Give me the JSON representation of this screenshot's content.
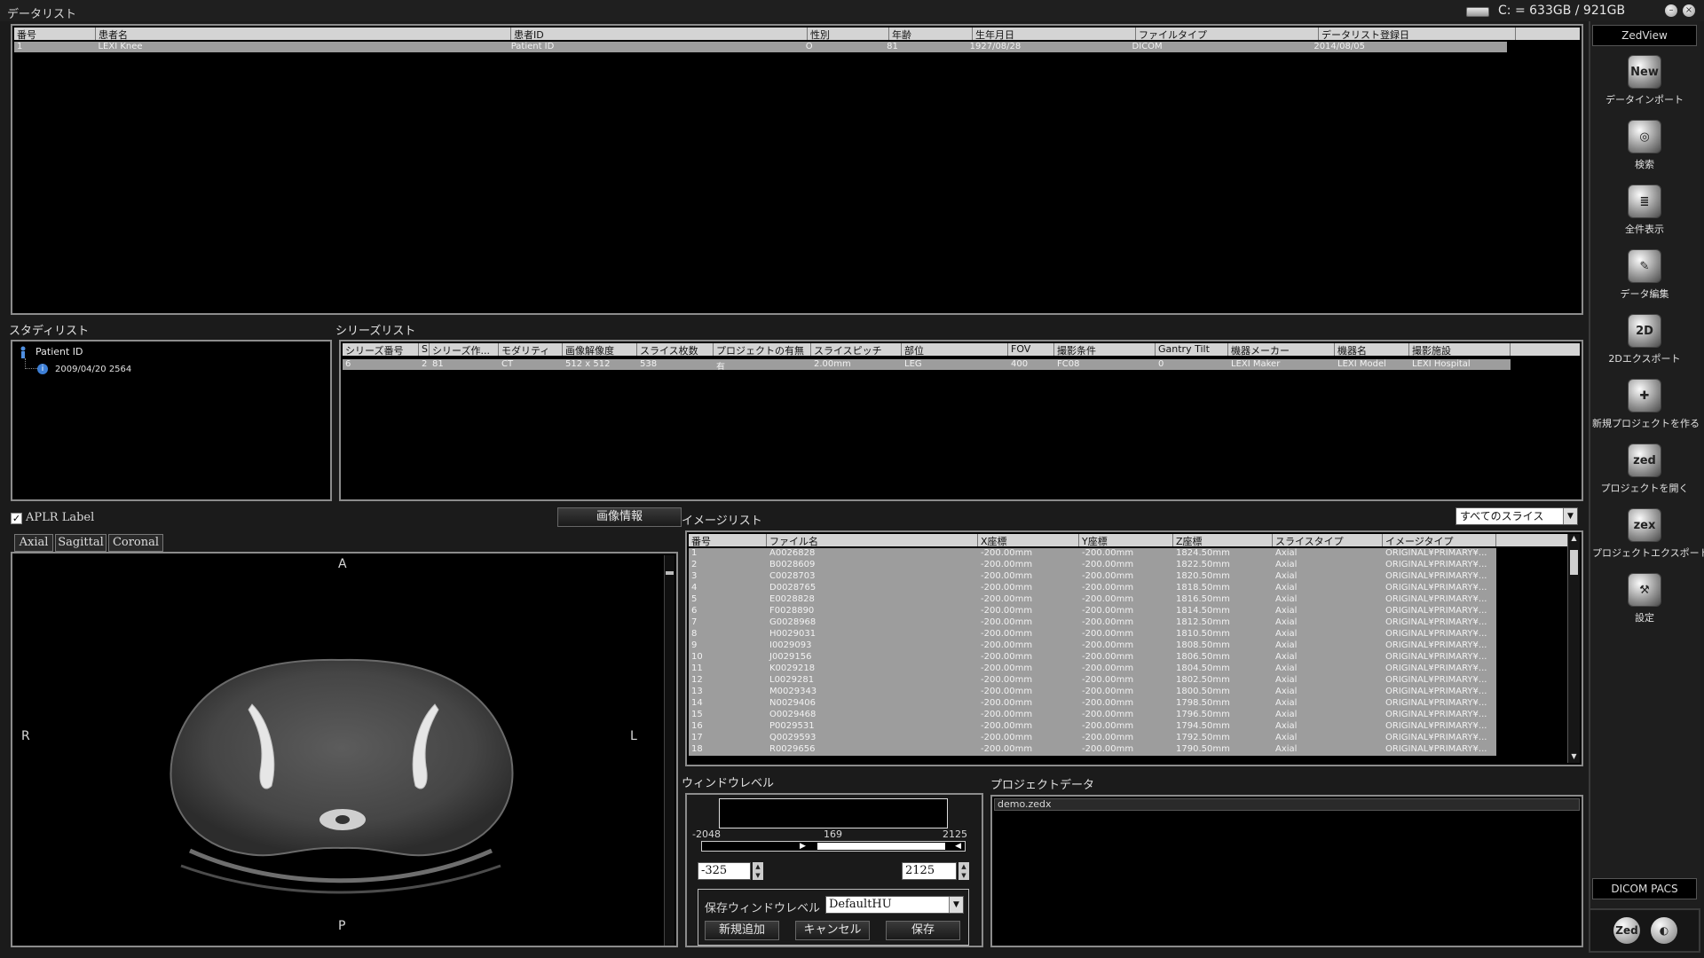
{
  "topbar": {
    "title": "データリスト",
    "drive": "C: = 633GB / 921GB",
    "min_icon": "minimize-icon",
    "close_icon": "close-icon"
  },
  "data_list": {
    "columns": [
      "番号",
      "患者名",
      "患者ID",
      "性別",
      "年齢",
      "生年月日",
      "ファイルタイプ",
      "データリスト登録日"
    ],
    "rows": [
      [
        "1",
        "LEXI Knee",
        "Patient ID",
        "O",
        "81",
        "1927/08/28",
        "DICOM",
        "2014/08/05"
      ]
    ]
  },
  "study_list": {
    "title": "スタディリスト",
    "root": "Patient ID",
    "child": "2009/04/20 2564"
  },
  "series_list": {
    "title": "シリーズリスト",
    "columns": [
      "シリーズ番号",
      "S",
      "シリーズ作...",
      "モダリティ",
      "画像解像度",
      "スライス枚数",
      "プロジェクトの有無",
      "スライスピッチ",
      "部位",
      "FOV",
      "撮影条件",
      "Gantry Tilt",
      "機器メーカー",
      "機器名",
      "撮影施設"
    ],
    "rows": [
      [
        "6",
        "2",
        "81",
        "CT",
        "512 x 512",
        "538",
        "有",
        "2.00mm",
        "LEG",
        "400",
        "FC08",
        "0",
        "LEXI Maker",
        "LEXI Model",
        "LEXI Hospital"
      ]
    ]
  },
  "viewer": {
    "aplr_label": "APLR Label",
    "image_info_button": "画像情報",
    "tabs": [
      "Axial",
      "Sagittal",
      "Coronal"
    ],
    "orient": {
      "top": "A",
      "bottom": "P",
      "left": "R",
      "right": "L"
    }
  },
  "image_list": {
    "title": "イメージリスト",
    "filter": "すべてのスライス",
    "columns": [
      "番号",
      "ファイル名",
      "X座標",
      "Y座標",
      "Z座標",
      "スライスタイプ",
      "イメージタイプ"
    ],
    "rows": [
      [
        "1",
        "A0026828",
        "-200.00mm",
        "-200.00mm",
        "1824.50mm",
        "Axial",
        "ORIGINAL¥PRIMARY¥..."
      ],
      [
        "2",
        "B0028609",
        "-200.00mm",
        "-200.00mm",
        "1822.50mm",
        "Axial",
        "ORIGINAL¥PRIMARY¥..."
      ],
      [
        "3",
        "C0028703",
        "-200.00mm",
        "-200.00mm",
        "1820.50mm",
        "Axial",
        "ORIGINAL¥PRIMARY¥..."
      ],
      [
        "4",
        "D0028765",
        "-200.00mm",
        "-200.00mm",
        "1818.50mm",
        "Axial",
        "ORIGINAL¥PRIMARY¥..."
      ],
      [
        "5",
        "E0028828",
        "-200.00mm",
        "-200.00mm",
        "1816.50mm",
        "Axial",
        "ORIGINAL¥PRIMARY¥..."
      ],
      [
        "6",
        "F0028890",
        "-200.00mm",
        "-200.00mm",
        "1814.50mm",
        "Axial",
        "ORIGINAL¥PRIMARY¥..."
      ],
      [
        "7",
        "G0028968",
        "-200.00mm",
        "-200.00mm",
        "1812.50mm",
        "Axial",
        "ORIGINAL¥PRIMARY¥..."
      ],
      [
        "8",
        "H0029031",
        "-200.00mm",
        "-200.00mm",
        "1810.50mm",
        "Axial",
        "ORIGINAL¥PRIMARY¥..."
      ],
      [
        "9",
        "I0029093",
        "-200.00mm",
        "-200.00mm",
        "1808.50mm",
        "Axial",
        "ORIGINAL¥PRIMARY¥..."
      ],
      [
        "10",
        "J0029156",
        "-200.00mm",
        "-200.00mm",
        "1806.50mm",
        "Axial",
        "ORIGINAL¥PRIMARY¥..."
      ],
      [
        "11",
        "K0029218",
        "-200.00mm",
        "-200.00mm",
        "1804.50mm",
        "Axial",
        "ORIGINAL¥PRIMARY¥..."
      ],
      [
        "12",
        "L0029281",
        "-200.00mm",
        "-200.00mm",
        "1802.50mm",
        "Axial",
        "ORIGINAL¥PRIMARY¥..."
      ],
      [
        "13",
        "M0029343",
        "-200.00mm",
        "-200.00mm",
        "1800.50mm",
        "Axial",
        "ORIGINAL¥PRIMARY¥..."
      ],
      [
        "14",
        "N0029406",
        "-200.00mm",
        "-200.00mm",
        "1798.50mm",
        "Axial",
        "ORIGINAL¥PRIMARY¥..."
      ],
      [
        "15",
        "O0029468",
        "-200.00mm",
        "-200.00mm",
        "1796.50mm",
        "Axial",
        "ORIGINAL¥PRIMARY¥..."
      ],
      [
        "16",
        "P0029531",
        "-200.00mm",
        "-200.00mm",
        "1794.50mm",
        "Axial",
        "ORIGINAL¥PRIMARY¥..."
      ],
      [
        "17",
        "Q0029593",
        "-200.00mm",
        "-200.00mm",
        "1792.50mm",
        "Axial",
        "ORIGINAL¥PRIMARY¥..."
      ],
      [
        "18",
        "R0029656",
        "-200.00mm",
        "-200.00mm",
        "1790.50mm",
        "Axial",
        "ORIGINAL¥PRIMARY¥..."
      ]
    ]
  },
  "window_level": {
    "title": "ウィンドウレベル",
    "min": "-2048",
    "mid": "169",
    "max": "2125",
    "low_value": "-325",
    "high_value": "2125",
    "save_label": "保存ウィンドウレベル",
    "preset": "DefaultHU",
    "add_button": "新規追加",
    "cancel_button": "キャンセル",
    "save_button": "保存"
  },
  "project_data": {
    "title": "プロジェクトデータ",
    "item": "demo.zedx"
  },
  "sidebar": {
    "title": "ZedView",
    "items": [
      {
        "label": "データインポート",
        "icon": "new-import-icon",
        "glyph": "New"
      },
      {
        "label": "検索",
        "icon": "search-icon",
        "glyph": "◎"
      },
      {
        "label": "全件表示",
        "icon": "list-all-icon",
        "glyph": "≣"
      },
      {
        "label": "データ編集",
        "icon": "edit-icon",
        "glyph": "✎"
      },
      {
        "label": "2Dエクスポート",
        "icon": "export-2d-icon",
        "glyph": "2D"
      },
      {
        "label": "新規プロジェクトを作る",
        "icon": "new-project-icon",
        "glyph": "✚"
      },
      {
        "label": "プロジェクトを開く",
        "icon": "open-project-icon",
        "glyph": "zed"
      },
      {
        "label": "プロジェクトエクスポート",
        "icon": "project-export-icon",
        "glyph": "zex"
      },
      {
        "label": "設定",
        "icon": "settings-icon",
        "glyph": "⚒"
      }
    ],
    "footer": "DICOM PACS",
    "zed_logo": "Zed"
  }
}
